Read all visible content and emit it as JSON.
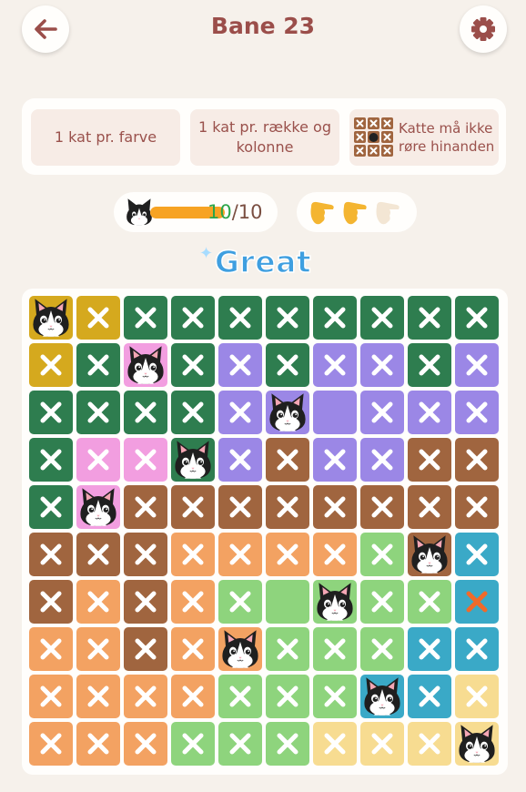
{
  "header": {
    "title": "Bane 23",
    "back_icon": "arrow-left-icon",
    "settings_icon": "gear-icon"
  },
  "rules": [
    {
      "text": "1 kat pr. farve"
    },
    {
      "text": "1 kat pr. række og kolonne"
    },
    {
      "text": "Katte må ikke røre hinanden",
      "icon": "grid-cat-icon"
    }
  ],
  "progress": {
    "done": "10",
    "total": "/10",
    "fraction": 1.0
  },
  "hints": {
    "available": 2,
    "total": 3,
    "icon": "hint-hand-icon"
  },
  "feedback": "Great",
  "colors": {
    "Y": "#d5a91e",
    "G": "#2e7d4f",
    "P": "#9b87e6",
    "K": "#f29ee0",
    "B": "#a0653f",
    "O": "#f3a262",
    "L": "#8ed47d",
    "T": "#3aa9c7",
    "C": "#f7dc91"
  },
  "board": {
    "rows": [
      [
        "Y",
        "Y",
        "G",
        "G",
        "G",
        "G",
        "G",
        "G",
        "G",
        "G"
      ],
      [
        "Y",
        "G",
        "K",
        "G",
        "P",
        "G",
        "P",
        "P",
        "G",
        "P"
      ],
      [
        "G",
        "G",
        "G",
        "G",
        "P",
        "P",
        "P",
        "P",
        "P",
        "P"
      ],
      [
        "G",
        "K",
        "K",
        "G",
        "P",
        "B",
        "P",
        "P",
        "B",
        "B"
      ],
      [
        "G",
        "K",
        "B",
        "B",
        "B",
        "B",
        "B",
        "B",
        "B",
        "B"
      ],
      [
        "B",
        "B",
        "B",
        "O",
        "O",
        "O",
        "O",
        "L",
        "B",
        "T"
      ],
      [
        "B",
        "O",
        "B",
        "O",
        "L",
        "L",
        "L",
        "L",
        "L",
        "T"
      ],
      [
        "O",
        "O",
        "B",
        "O",
        "O",
        "L",
        "L",
        "L",
        "T",
        "T"
      ],
      [
        "O",
        "O",
        "O",
        "O",
        "L",
        "L",
        "L",
        "T",
        "T",
        "C"
      ],
      [
        "O",
        "O",
        "O",
        "L",
        "L",
        "L",
        "C",
        "C",
        "C",
        "C"
      ]
    ],
    "states": [
      [
        "C",
        "X",
        "X",
        "X",
        "X",
        "X",
        "X",
        "X",
        "X",
        "X"
      ],
      [
        "X",
        "X",
        "C",
        "X",
        "X",
        "X",
        "X",
        "X",
        "X",
        "X"
      ],
      [
        "X",
        "X",
        "X",
        "X",
        "X",
        "C",
        "E",
        "X",
        "X",
        "X"
      ],
      [
        "X",
        "X",
        "X",
        "C",
        "X",
        "X",
        "X",
        "X",
        "X",
        "X"
      ],
      [
        "X",
        "C",
        "X",
        "X",
        "X",
        "X",
        "X",
        "X",
        "X",
        "X"
      ],
      [
        "X",
        "X",
        "X",
        "X",
        "X",
        "X",
        "X",
        "X",
        "C",
        "X"
      ],
      [
        "X",
        "X",
        "X",
        "X",
        "X",
        "E",
        "C",
        "X",
        "X",
        "R"
      ],
      [
        "X",
        "X",
        "X",
        "X",
        "C",
        "X",
        "X",
        "X",
        "X",
        "X"
      ],
      [
        "X",
        "X",
        "X",
        "X",
        "X",
        "X",
        "X",
        "C",
        "X",
        "X"
      ],
      [
        "X",
        "X",
        "X",
        "X",
        "X",
        "X",
        "X",
        "X",
        "X",
        "C"
      ]
    ]
  }
}
